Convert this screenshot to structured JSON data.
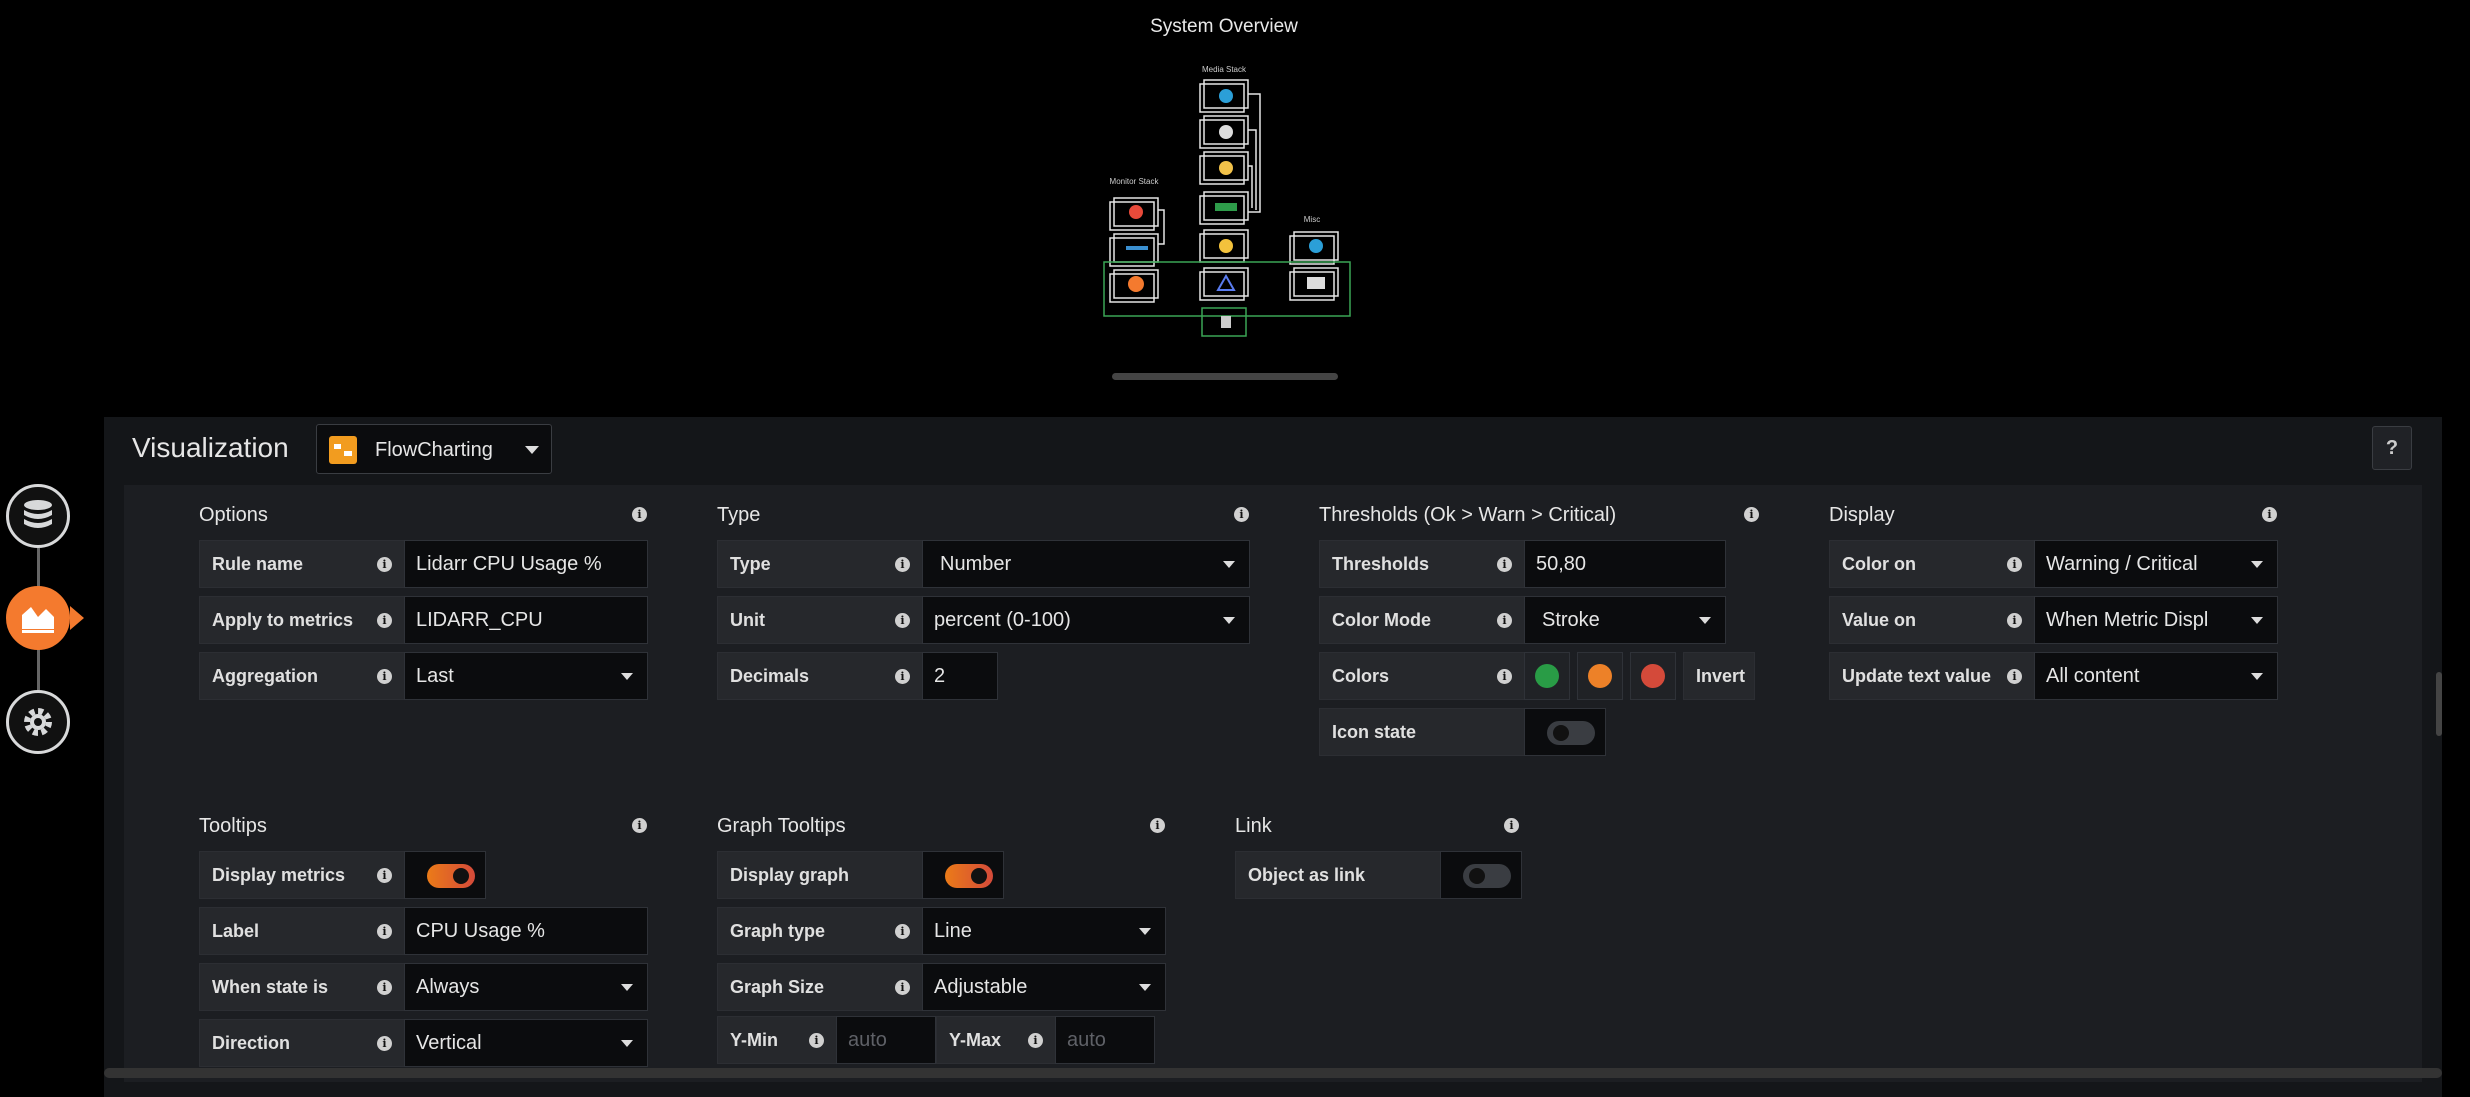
{
  "preview": {
    "title": "System Overview",
    "diagram_labels": {
      "media": "Media Stack",
      "monitor": "Monitor Stack",
      "misc": "Misc"
    }
  },
  "header": {
    "label": "Visualization",
    "plugin": "FlowCharting",
    "help": "?"
  },
  "nav": {
    "items": [
      "queries-icon",
      "visualization-icon",
      "general-icon"
    ]
  },
  "options": {
    "title": "Options",
    "rule_name_label": "Rule name",
    "rule_name_value": "Lidarr CPU Usage %",
    "apply_label": "Apply to metrics",
    "apply_value": "LIDARR_CPU",
    "aggregation_label": "Aggregation",
    "aggregation_value": "Last"
  },
  "type": {
    "title": "Type",
    "type_label": "Type",
    "type_value": "Number",
    "unit_label": "Unit",
    "unit_value": "percent (0-100)",
    "decimals_label": "Decimals",
    "decimals_value": "2"
  },
  "thresholds": {
    "title": "Thresholds (Ok > Warn > Critical)",
    "thresholds_label": "Thresholds",
    "thresholds_value": "50,80",
    "color_mode_label": "Color Mode",
    "color_mode_value": "Stroke",
    "colors_label": "Colors",
    "colors": [
      "#299c46",
      "#ed8128",
      "#d44a3a"
    ],
    "invert_label": "Invert",
    "icon_state_label": "Icon state",
    "icon_state_on": false
  },
  "display": {
    "title": "Display",
    "color_on_label": "Color on",
    "color_on_value": "Warning / Critical",
    "value_on_label": "Value on",
    "value_on_value": "When Metric Displ",
    "update_label": "Update text value",
    "update_value": "All content"
  },
  "tooltips": {
    "title": "Tooltips",
    "display_metrics_label": "Display metrics",
    "display_metrics_on": true,
    "label_label": "Label",
    "label_value": "CPU Usage %",
    "when_label": "When state is",
    "when_value": "Always",
    "direction_label": "Direction",
    "direction_value": "Vertical"
  },
  "graph_tooltips": {
    "title": "Graph Tooltips",
    "display_graph_label": "Display graph",
    "display_graph_on": true,
    "graph_type_label": "Graph type",
    "graph_type_value": "Line",
    "graph_size_label": "Graph Size",
    "graph_size_value": "Adjustable",
    "ymin_label": "Y-Min",
    "ymin_placeholder": "auto",
    "ymax_label": "Y-Max",
    "ymax_placeholder": "auto"
  },
  "link": {
    "title": "Link",
    "object_link_label": "Object as link",
    "object_link_on": false
  }
}
